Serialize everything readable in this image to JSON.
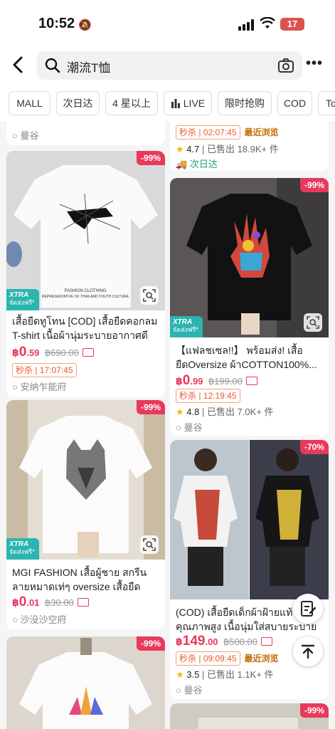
{
  "status": {
    "time": "10:52",
    "battery": "17"
  },
  "search": {
    "query": "潮流T恤"
  },
  "filters": [
    "MALL",
    "次日达",
    "4 星以上",
    "LIVE",
    "限时抢购",
    "COD",
    "To"
  ],
  "partial_top": {
    "left_loc": "曼谷",
    "right_flash": "秒杀 | 02:07:45",
    "right_recent": "最近浏览",
    "right_score": "4.7",
    "right_sold": "已售出 18.9K+ 件",
    "right_ship": "次日达"
  },
  "products": [
    {
      "discount": "-99%",
      "xtra": {
        "brand": "XTRA",
        "sub": "จัดส่งฟรี*"
      },
      "title": "เสื้อยืดทูโทน [COD] เสื้อยืดคอกลม T-shirt เนื้อผ้านุ่มระบายอากาศดี T...",
      "price_cur": "฿",
      "price_int": "0",
      "price_dec": ".59",
      "orig_price": "฿690.00",
      "flash": "秒杀 | 17:07:45",
      "location": "安纳乍能府"
    },
    {
      "discount": "-99%",
      "xtra": {
        "brand": "XTRA",
        "sub": "จัดส่งฟรี*"
      },
      "title": "【แฟลชเซล!!】 พร้อมส่ง! เสื้อยืดOversize ผ้าCOTTON100%...",
      "price_cur": "฿",
      "price_int": "0",
      "price_dec": ".99",
      "orig_price": "฿199.00",
      "flash": "秒杀 | 12:19:45",
      "score": "4.8",
      "sold": "已售出 7.0K+ 件",
      "location": "曼谷"
    },
    {
      "discount": "-99%",
      "xtra": {
        "brand": "XTRA",
        "sub": "จัดส่งฟรี*"
      },
      "title": "MGI FASHION เสื้อผู้ชาย สกรีนลายหมาดเท่ๆ oversize เสื้อยืดคอกลม...",
      "price_cur": "฿",
      "price_int": "0",
      "price_dec": ".01",
      "orig_price": "฿30.00",
      "location": "沙没沙空府"
    },
    {
      "discount": "-70%",
      "title": "(COD) เสื้อยืดเด็กผ้าฝ้ายแท้คุณภาพสูง เนื้อนุ่มใส่สบายระบายอากาศ...",
      "price_cur": "฿",
      "price_int": "149",
      "price_dec": ".00",
      "orig_price": "฿500.00",
      "flash": "秒杀 | 09:09:45",
      "recent": "最近浏览",
      "score": "3.5",
      "sold": "已售出 1.1K+ 件",
      "location": "曼谷"
    },
    {
      "discount": "-99%"
    },
    {
      "discount": "-99%"
    }
  ],
  "colors": {
    "accent": "#e8395c",
    "xtra": "#2ab5b0",
    "ship": "#1a9e7a"
  }
}
